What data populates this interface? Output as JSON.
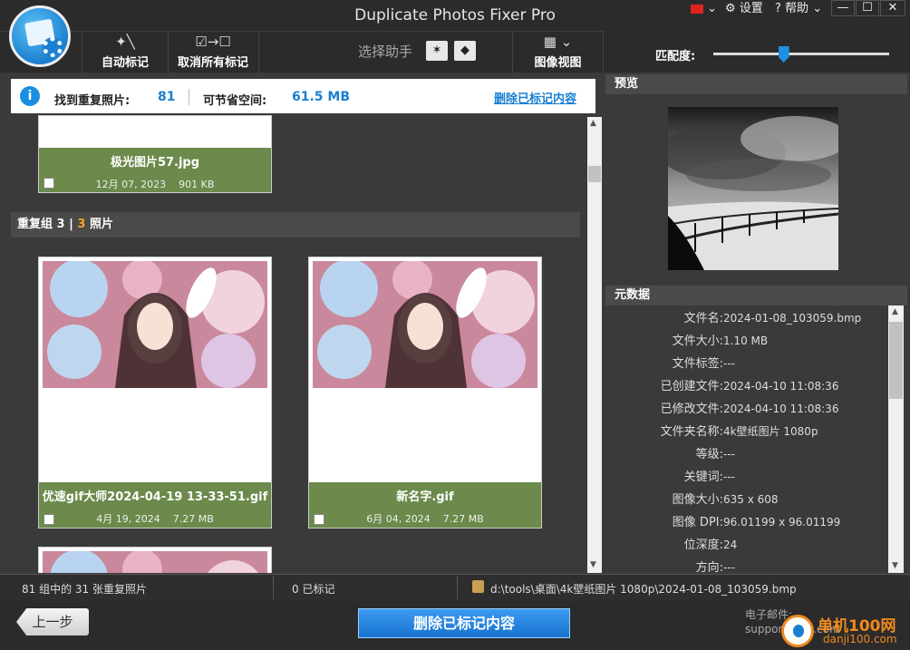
{
  "app": {
    "title": "Duplicate Photos Fixer Pro"
  },
  "topbar": {
    "flag": "🇨🇳",
    "settings": "设置",
    "help": "帮助",
    "min": "—",
    "max": "☐",
    "close": "✕"
  },
  "toolbar": {
    "auto_mark": "自动标记",
    "unmark_all": "取消所有标记",
    "assistant": "选择助手",
    "image_view": "图像视图"
  },
  "match": {
    "label": "匹配度:",
    "level": 0.4
  },
  "info": {
    "found_label": "找到重复照片:",
    "found_value": "81",
    "save_label": "可节省空间:",
    "save_value": "61.5 MB",
    "delete_link": "删除已标记内容"
  },
  "groups": [
    {
      "cards": [
        {
          "name": "极光图片57.jpg",
          "date": "12月 07, 2023",
          "size": "901 KB"
        }
      ]
    },
    {
      "header": {
        "prefix": "重复组 3 |",
        "count": "3",
        "suffix": "照片"
      },
      "cards": [
        {
          "name": "优速gif大师2024-04-19 13-33-51.gif",
          "date": "4月 19, 2024",
          "size": "7.27 MB"
        },
        {
          "name": "新名字.gif",
          "date": "6月 04, 2024",
          "size": "7.27 MB"
        }
      ]
    }
  ],
  "preview": {
    "header": "预览"
  },
  "metadata": {
    "header": "元数据",
    "rows": [
      {
        "k": "文件名:",
        "v": "2024-01-08_103059.bmp"
      },
      {
        "k": "文件大小:",
        "v": "1.10 MB"
      },
      {
        "k": "文件标签:",
        "v": "---"
      },
      {
        "k": "已创建文件:",
        "v": "2024-04-10 11:08:36"
      },
      {
        "k": "已修改文件:",
        "v": "2024-04-10 11:08:36"
      },
      {
        "k": "文件夹名称:",
        "v": "4k壁纸图片 1080p"
      },
      {
        "k": "等级:",
        "v": "---"
      },
      {
        "k": "关键词:",
        "v": "---"
      },
      {
        "k": "图像大小:",
        "v": "635 x 608"
      },
      {
        "k": "图像 DPI:",
        "v": "96.01199 x 96.01199"
      },
      {
        "k": "位深度:",
        "v": "24"
      },
      {
        "k": "方向:",
        "v": "---"
      }
    ]
  },
  "status": {
    "summary": "81 组中的 31 张重复照片",
    "marked": "0 已标记",
    "path": "d:\\tools\\桌面\\4k壁纸图片 1080p\\2024-01-08_103059.bmp"
  },
  "bottom": {
    "back": "上一步",
    "delete": "删除已标记内容",
    "email_label": "电子邮件:",
    "email_value": "support@sy        .com"
  },
  "watermark": {
    "brand": "单机100网",
    "domain": "danji100.com"
  }
}
